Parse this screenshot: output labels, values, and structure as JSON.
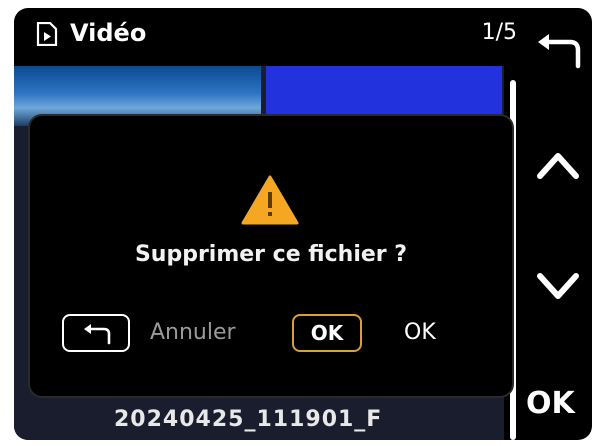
{
  "header": {
    "title": "Vidéo",
    "counter": "1/5",
    "title_icon": "video-file-icon"
  },
  "gallery": {
    "filename": "20240425_111901_F"
  },
  "side_buttons": {
    "back_icon": "back-arrow-icon",
    "up_icon": "chevron-up-icon",
    "down_icon": "chevron-down-icon",
    "ok_label": "OK"
  },
  "dialog": {
    "icon": "warning-icon",
    "message": "Supprimer ce fichier ?",
    "cancel_key_icon": "back-arrow-icon",
    "cancel_label": "Annuler",
    "ok_key_label": "OK",
    "ok_label": "OK"
  },
  "colors": {
    "background": "#000000",
    "warning": "#f5a623",
    "ok_key_border": "#d9a03a",
    "selected_thumb": "#2233dd"
  }
}
